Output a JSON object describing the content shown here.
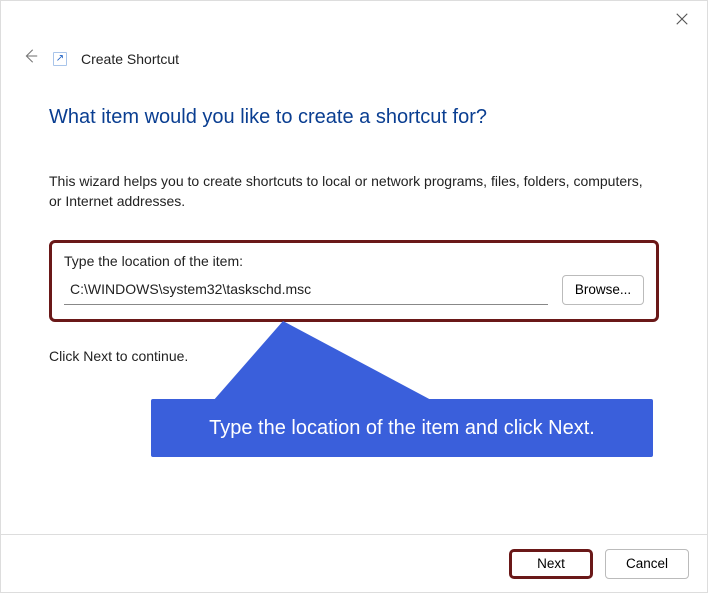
{
  "window": {
    "title": "Create Shortcut"
  },
  "content": {
    "heading": "What item would you like to create a shortcut for?",
    "description": "This wizard helps you to create shortcuts to local or network programs, files, folders, computers, or Internet addresses.",
    "input_label": "Type the location of the item:",
    "input_value": "C:\\WINDOWS\\system32\\taskschd.msc",
    "browse_label": "Browse...",
    "continue_text": "Click Next to continue."
  },
  "annotation": {
    "text": "Type the location of the item and click Next."
  },
  "footer": {
    "next_label": "Next",
    "cancel_label": "Cancel"
  }
}
